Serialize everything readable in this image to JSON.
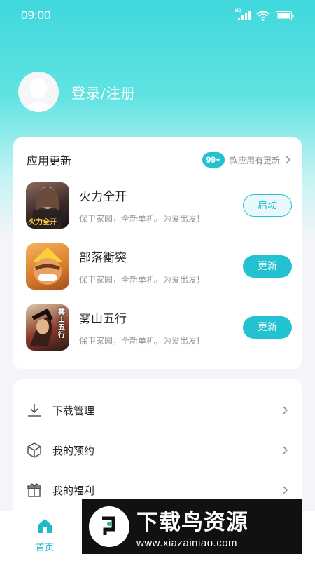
{
  "status_bar": {
    "time": "09:00",
    "network_label": "HD"
  },
  "profile": {
    "login_label": "登录/注册"
  },
  "app_updates": {
    "title": "应用更新",
    "count_badge": "99+",
    "subtitle": "款应用有更新",
    "apps": [
      {
        "name": "火力全开",
        "description": "保卫家园，全新单机，为爱出发!",
        "button": "启动",
        "icon_text": "火力全开"
      },
      {
        "name": "部落衝突",
        "description": "保卫家园，全新单机，为爱出发!",
        "button": "更新"
      },
      {
        "name": "雾山五行",
        "description": "保卫家园，全新单机，为爱出发!",
        "button": "更新",
        "icon_text": "雾山五行"
      }
    ]
  },
  "menu": {
    "items": [
      {
        "label": "下载管理",
        "icon": "download-icon"
      },
      {
        "label": "我的预约",
        "icon": "box-icon"
      },
      {
        "label": "我的福利",
        "icon": "gift-icon"
      }
    ]
  },
  "bottom_nav": {
    "items": [
      {
        "label": "首页",
        "icon": "home-icon",
        "active": true
      }
    ]
  },
  "watermark": {
    "title": "下载鸟资源",
    "url": "www.xiazainiao.com"
  },
  "colors": {
    "accent": "#22c2d2",
    "hero_top": "#3fd8dc",
    "background": "#f3f5f8"
  }
}
